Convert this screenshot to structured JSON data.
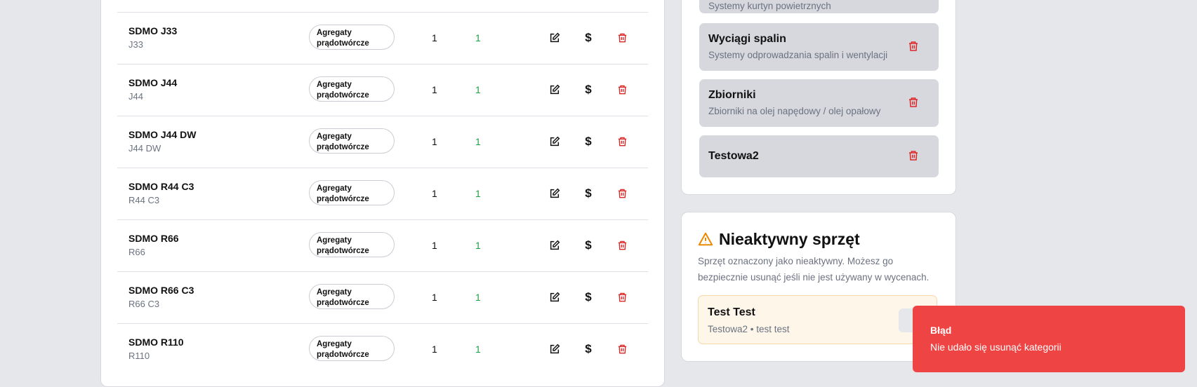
{
  "products": [
    {
      "name": "SDMO J33",
      "code": "J33",
      "category": "Agregaty prądotwórcze",
      "qty": "1",
      "active": "1"
    },
    {
      "name": "SDMO J44",
      "code": "J44",
      "category": "Agregaty prądotwórcze",
      "qty": "1",
      "active": "1"
    },
    {
      "name": "SDMO J44 DW",
      "code": "J44 DW",
      "category": "Agregaty prądotwórcze",
      "qty": "1",
      "active": "1"
    },
    {
      "name": "SDMO R44 C3",
      "code": "R44 C3",
      "category": "Agregaty prądotwórcze",
      "qty": "1",
      "active": "1"
    },
    {
      "name": "SDMO R66",
      "code": "R66",
      "category": "Agregaty prądotwórcze",
      "qty": "1",
      "active": "1"
    },
    {
      "name": "SDMO R66 C3",
      "code": "R66 C3",
      "category": "Agregaty prądotwórcze",
      "qty": "1",
      "active": "1"
    },
    {
      "name": "SDMO R110",
      "code": "R110",
      "category": "Agregaty prądotwórcze",
      "qty": "1",
      "active": "1"
    }
  ],
  "actions": {
    "price_symbol": "$"
  },
  "categories": [
    {
      "title": "",
      "description": "Systemy kurtyn powietrznych"
    },
    {
      "title": "Wyciągi spalin",
      "description": "Systemy odprowadzania spalin i wentylacji"
    },
    {
      "title": "Zbiorniki",
      "description": "Zbiorniki na olej napędowy / olej opałowy"
    },
    {
      "title": "Testowa2",
      "description": ""
    }
  ],
  "inactive": {
    "title": "Nieaktywny sprzęt",
    "description": "Sprzęt oznaczony jako nieaktywny. Możesz go bezpiecznie usunąć jeśli nie jest używany w wycenach.",
    "items": [
      {
        "title": "Test Test",
        "subtitle": "Testowa2 • test test"
      }
    ]
  },
  "toast": {
    "title": "Błąd",
    "message": "Nie udało się usunąć kategorii"
  },
  "colors": {
    "accent_green": "#22a046",
    "danger": "#dc2626",
    "warning": "#ea8a00",
    "toast_bg": "#ef4444"
  }
}
